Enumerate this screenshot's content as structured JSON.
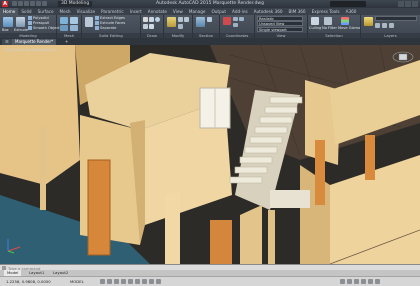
{
  "titlebar": {
    "app_title": "Autodesk AutoCAD 2015   Marquette Render.dwg",
    "workspace": "3D Modeling",
    "logo": "A"
  },
  "ribbon_tabs": [
    "Home",
    "Solid",
    "Surface",
    "Mesh",
    "Visualize",
    "Parametric",
    "Insert",
    "Annotate",
    "View",
    "Manage",
    "Output",
    "Add-ins",
    "Autodesk 360",
    "BIM 360",
    "Express Tools",
    "A360"
  ],
  "ribbon": {
    "panels": [
      {
        "label": "Modeling"
      },
      {
        "label": "Mesh"
      },
      {
        "label": "Solid Editing"
      },
      {
        "label": "Draw"
      },
      {
        "label": "Modify"
      },
      {
        "label": "Section"
      },
      {
        "label": "Coordinates"
      },
      {
        "label": "View"
      },
      {
        "label": "Selection"
      },
      {
        "label": "Layers"
      }
    ],
    "modeling_buttons": [
      "Box",
      "Extrude"
    ],
    "modeling_rows": [
      "Polysolid",
      "Presspull",
      "Smooth Object"
    ],
    "solid_edit_rows": [
      "Extract Edges",
      "Extrude Faces",
      "Separate"
    ],
    "view_dropdowns": [
      "Realistic",
      "Unsaved View",
      "Single viewport"
    ],
    "culling_label": "Culling",
    "gizmo_label": "No Filter",
    "move_gizmo_label": "Move Gizmo",
    "section_label": "Section Plane"
  },
  "doc_tabs": [
    "Marquette Render*"
  ],
  "viewport": {
    "label": "[-][Custom View][Realistic]",
    "compass_letters": {
      "n": "N",
      "s": "S",
      "e": "E",
      "w": "W"
    },
    "ucs": {
      "x": "X",
      "y": "Y",
      "z": "Z"
    }
  },
  "command_line": {
    "placeholder": "Type a command"
  },
  "layout_tabs": [
    "Model",
    "Layout1",
    "Layout2"
  ],
  "status": {
    "coords": "1.2256, 0.9808, 0.0000",
    "mode": "MODEL"
  },
  "colors": {
    "wall": "#e9c98b",
    "wall_shadow": "#cfad6d",
    "wall_dark": "#b89558",
    "door": "#d98a3a",
    "floor": "#5e4a38",
    "ground": "#2c5a6c",
    "stair": "#e6e0cf"
  }
}
